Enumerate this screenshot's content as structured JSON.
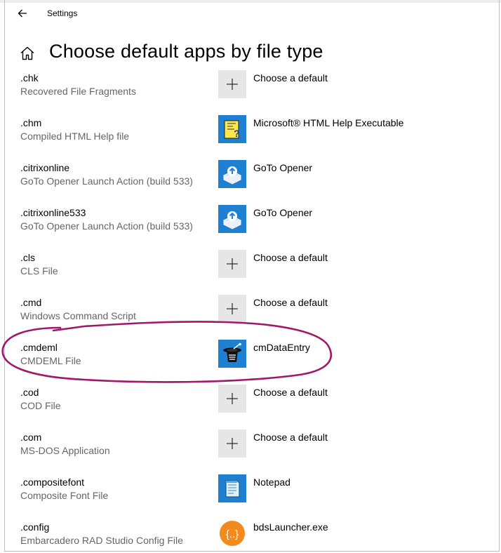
{
  "window": {
    "title": "Settings"
  },
  "header": {
    "title": "Choose default apps by file type"
  },
  "rows": [
    {
      "ext": ".chk",
      "desc": "Recovered File Fragments",
      "app": "Choose a default",
      "icon": "plus-icon"
    },
    {
      "ext": ".chm",
      "desc": "Compiled HTML Help file",
      "app": "Microsoft® HTML Help Executable",
      "icon": "html-help-icon"
    },
    {
      "ext": ".citrixonline",
      "desc": "GoTo Opener Launch Action (build 533)",
      "app": "GoTo Opener",
      "icon": "goto-opener-icon"
    },
    {
      "ext": ".citrixonline533",
      "desc": "GoTo Opener Launch Action (build 533)",
      "app": "GoTo Opener",
      "icon": "goto-opener-icon"
    },
    {
      "ext": ".cls",
      "desc": "CLS File",
      "app": "Choose a default",
      "icon": "plus-icon"
    },
    {
      "ext": ".cmd",
      "desc": "Windows Command Script",
      "app": "Choose a default",
      "icon": "plus-icon"
    },
    {
      "ext": ".cmdeml",
      "desc": "CMDEML File",
      "app": "cmDataEntry",
      "icon": "cmdataentry-icon"
    },
    {
      "ext": ".cod",
      "desc": "COD File",
      "app": "Choose a default",
      "icon": "plus-icon"
    },
    {
      "ext": ".com",
      "desc": "MS-DOS Application",
      "app": "Choose a default",
      "icon": "plus-icon"
    },
    {
      "ext": ".compositefont",
      "desc": "Composite Font File",
      "app": "Notepad",
      "icon": "notepad-icon"
    },
    {
      "ext": ".config",
      "desc": "Embarcadero RAD Studio Config File",
      "app": "bdsLauncher.exe",
      "icon": "bdslauncher-icon"
    }
  ],
  "colors": {
    "annotation": "#a0186a",
    "secondary_text": "#666666",
    "icon_blue": "#1f7fd1",
    "plus_tile": "#e6e6e6"
  }
}
